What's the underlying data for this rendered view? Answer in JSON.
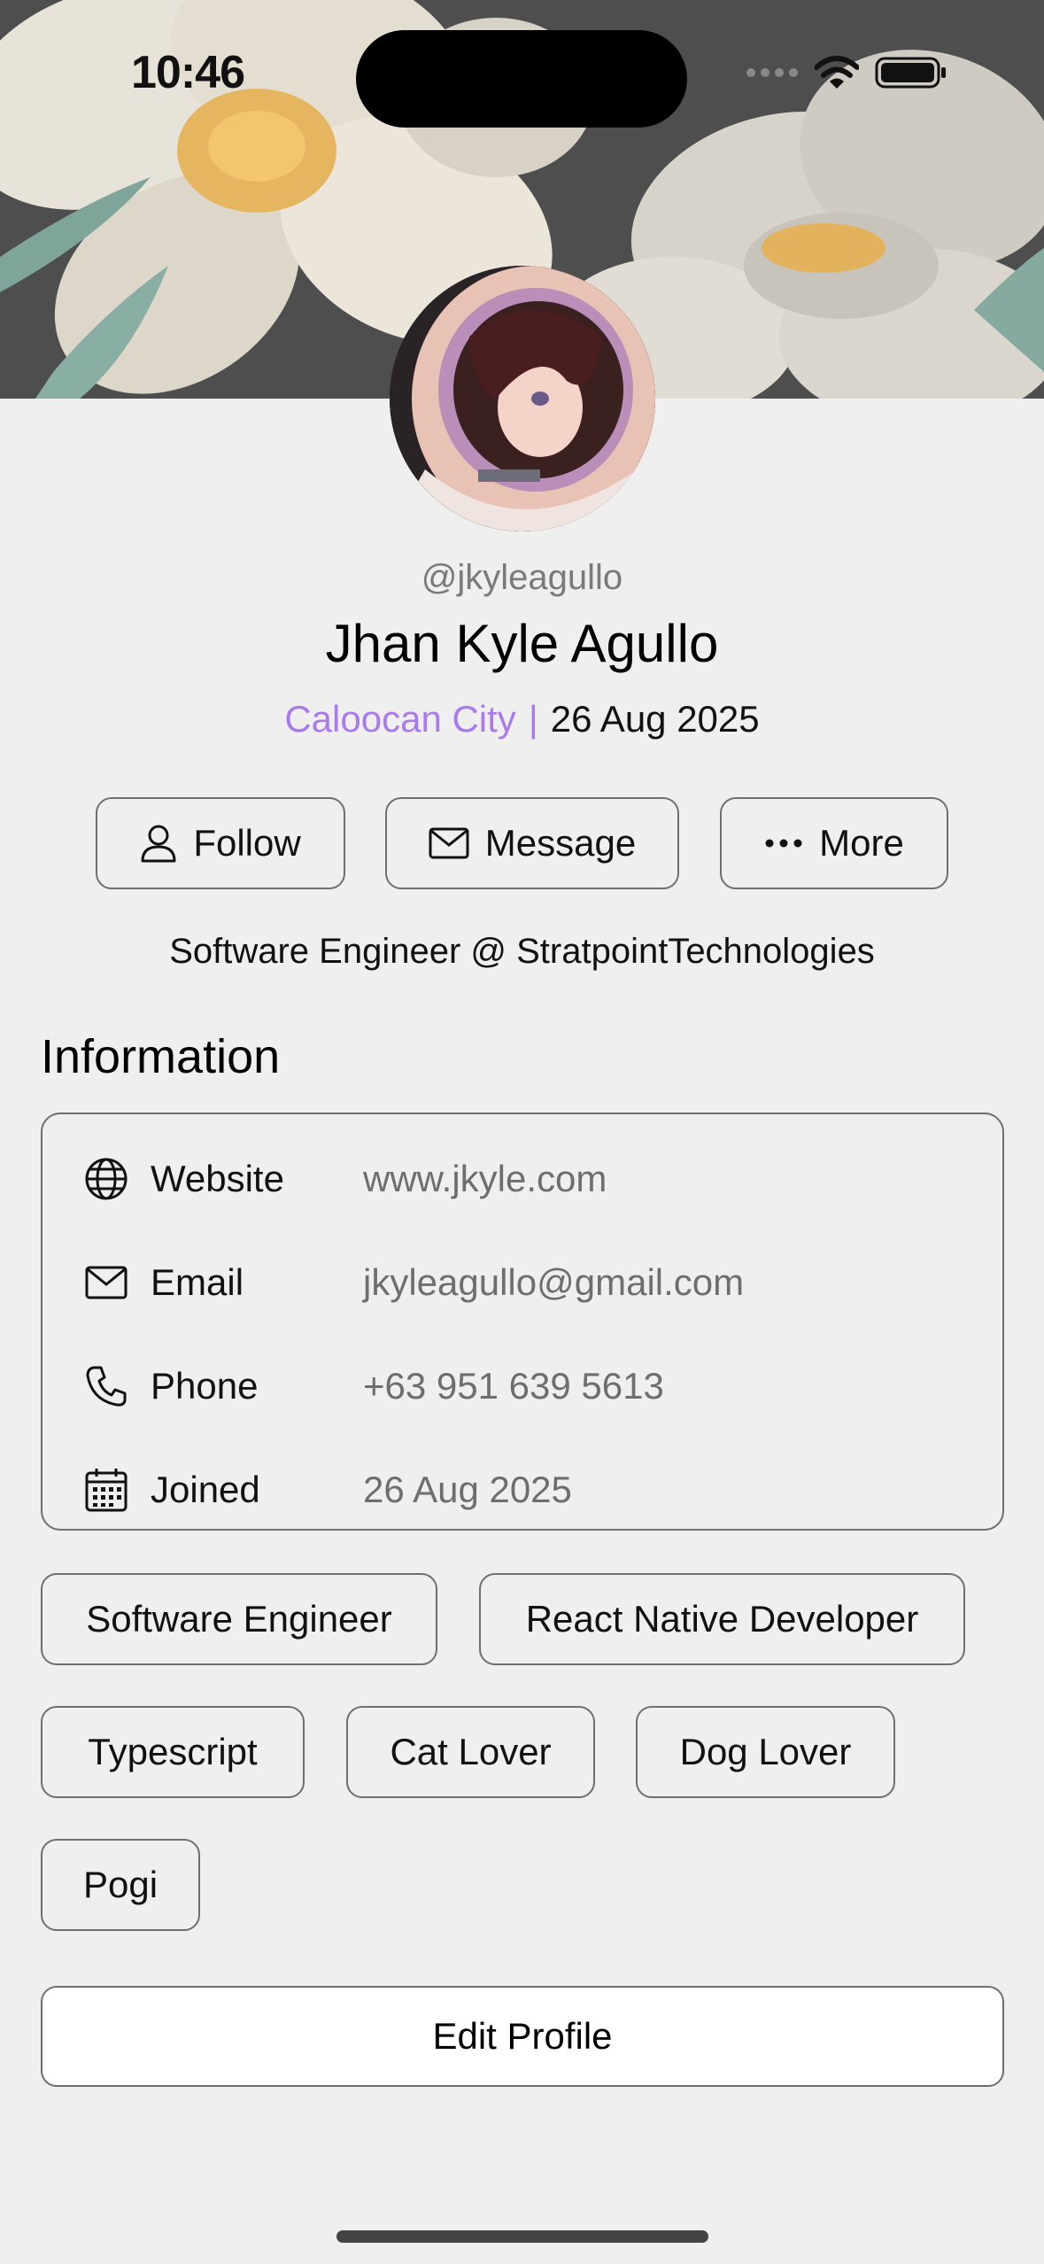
{
  "status_bar": {
    "time": "10:46"
  },
  "profile": {
    "handle": "@jkyleagullo",
    "name": "Jhan Kyle Agullo",
    "city": "Caloocan City",
    "separator": "|",
    "date": "26 Aug 2025",
    "bio": "Software Engineer @ StratpointTechnologies"
  },
  "actions": {
    "follow_label": "Follow",
    "message_label": "Message",
    "more_label": "More"
  },
  "information": {
    "title": "Information",
    "rows": [
      {
        "icon": "globe-icon",
        "label": "Website",
        "value": "www.jkyle.com"
      },
      {
        "icon": "mail-icon",
        "label": "Email",
        "value": "jkyleagullo@gmail.com"
      },
      {
        "icon": "phone-icon",
        "label": "Phone",
        "value": "+63 951 639 5613"
      },
      {
        "icon": "calendar-icon",
        "label": "Joined",
        "value": "26 Aug 2025"
      }
    ]
  },
  "tags": [
    "Software Engineer",
    "React Native Developer",
    "Typescript",
    "Cat Lover",
    "Dog Lover",
    "Pogi"
  ],
  "edit_profile_label": "Edit Profile",
  "colors": {
    "accent": "#a97bea",
    "background": "#efefef",
    "border": "#6f6f6f"
  }
}
